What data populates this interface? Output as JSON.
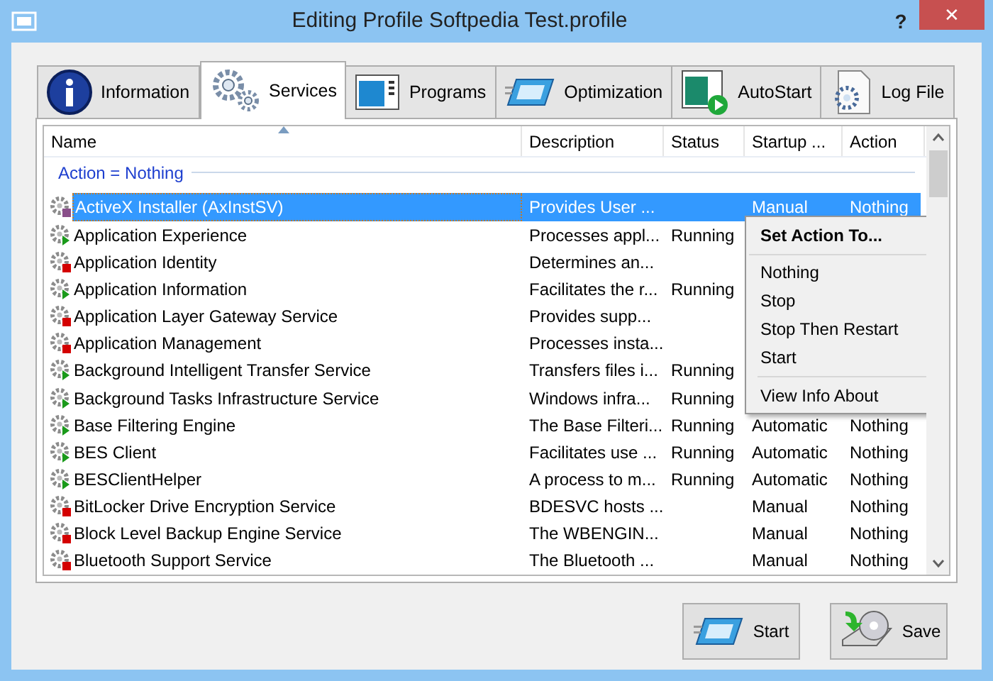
{
  "window": {
    "title": "Editing Profile Softpedia Test.profile",
    "help": "?",
    "close": "✕"
  },
  "tabs": [
    {
      "label": "Information",
      "selected": false
    },
    {
      "label": "Services",
      "selected": true
    },
    {
      "label": "Programs",
      "selected": false
    },
    {
      "label": "Optimization",
      "selected": false
    },
    {
      "label": "AutoStart",
      "selected": false
    },
    {
      "label": "Log File",
      "selected": false
    }
  ],
  "table": {
    "columns": [
      "Name",
      "Description",
      "Status",
      "Startup ...",
      "Action"
    ],
    "group": "Action = Nothing",
    "rows": [
      {
        "name": "ActiveX Installer (AxInstSV)",
        "description": "Provides User ...",
        "startup": "Manual",
        "action": "Nothing",
        "running": false,
        "selected": true
      },
      {
        "name": "Application Experience",
        "description": "Processes appl...",
        "status": "Running",
        "running": true,
        "selected": false
      },
      {
        "name": "Application Identity",
        "description": "Determines an...",
        "running": false,
        "selected": false
      },
      {
        "name": "Application Information",
        "description": "Facilitates the r...",
        "status": "Running",
        "running": true,
        "selected": false
      },
      {
        "name": "Application Layer Gateway Service",
        "description": "Provides supp...",
        "running": false,
        "selected": false
      },
      {
        "name": "Application Management",
        "description": "Processes insta...",
        "running": false,
        "selected": false
      },
      {
        "name": "Background Intelligent Transfer Service",
        "description": "Transfers files i...",
        "status": "Running",
        "running": true,
        "selected": false
      },
      {
        "name": "Background Tasks Infrastructure Service",
        "description": "Windows infra...",
        "status": "Running",
        "running": true,
        "selected": false
      },
      {
        "name": "Base Filtering Engine",
        "description": "The Base Filteri...",
        "status": "Running",
        "startup": "Automatic",
        "action": "Nothing",
        "running": true,
        "selected": false
      },
      {
        "name": "BES Client",
        "description": "Facilitates use ...",
        "status": "Running",
        "startup": "Automatic",
        "action": "Nothing",
        "running": true,
        "selected": false
      },
      {
        "name": "BESClientHelper",
        "description": "A process to m...",
        "status": "Running",
        "startup": "Automatic",
        "action": "Nothing",
        "running": true,
        "selected": false
      },
      {
        "name": "BitLocker Drive Encryption Service",
        "description": "BDESVC hosts ...",
        "startup": "Manual",
        "action": "Nothing",
        "running": false,
        "selected": false
      },
      {
        "name": "Block Level Backup Engine Service",
        "description": "The WBENGIN...",
        "startup": "Manual",
        "action": "Nothing",
        "running": false,
        "selected": false
      },
      {
        "name": "Bluetooth Support Service",
        "description": "The Bluetooth ...",
        "startup": "Manual",
        "action": "Nothing",
        "running": false,
        "selected": false
      }
    ]
  },
  "context_menu": {
    "title": "Set Action To...",
    "items": [
      {
        "label": "Nothing",
        "kind": "item"
      },
      {
        "label": "Stop",
        "kind": "item"
      },
      {
        "label": "Stop Then Restart",
        "kind": "item"
      },
      {
        "label": "Start",
        "kind": "item"
      },
      {
        "kind": "separator"
      },
      {
        "label": "View Info About",
        "kind": "item"
      }
    ]
  },
  "buttons": [
    {
      "label": "Start"
    },
    {
      "label": "Save"
    }
  ]
}
